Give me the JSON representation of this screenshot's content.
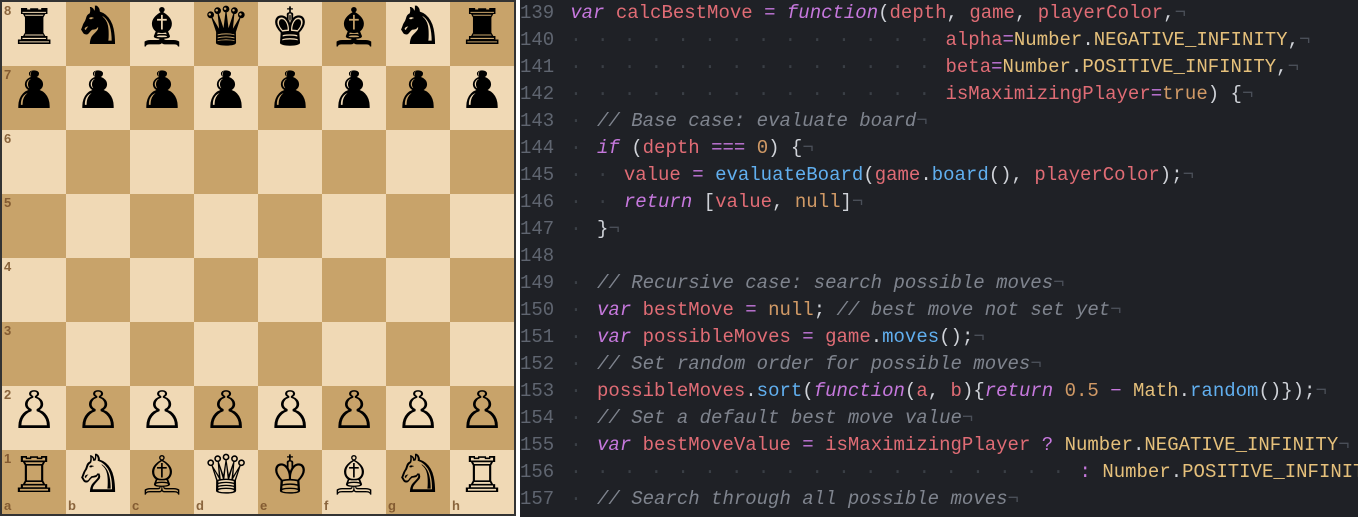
{
  "chess": {
    "ranks": [
      "8",
      "7",
      "6",
      "5",
      "4",
      "3",
      "2",
      "1"
    ],
    "files": [
      "a",
      "b",
      "c",
      "d",
      "e",
      "f",
      "g",
      "h"
    ],
    "position": [
      [
        "♜",
        "♞",
        "♝",
        "♛",
        "♚",
        "♝",
        "♞",
        "♜"
      ],
      [
        "♟",
        "♟",
        "♟",
        "♟",
        "♟",
        "♟",
        "♟",
        "♟"
      ],
      [
        "",
        "",
        "",
        "",
        "",
        "",
        "",
        ""
      ],
      [
        "",
        "",
        "",
        "",
        "",
        "",
        "",
        ""
      ],
      [
        "",
        "",
        "",
        "",
        "",
        "",
        "",
        ""
      ],
      [
        "",
        "",
        "",
        "",
        "",
        "",
        "",
        ""
      ],
      [
        "♙",
        "♙",
        "♙",
        "♙",
        "♙",
        "♙",
        "♙",
        "♙"
      ],
      [
        "♖",
        "♘",
        "♗",
        "♕",
        "♔",
        "♗",
        "♘",
        "♖"
      ]
    ],
    "colors": {
      "light": "#f0d9b5",
      "dark": "#c8a36a"
    }
  },
  "editor": {
    "first_line": 139,
    "lines": [
      {
        "n": 139,
        "tokens": [
          {
            "t": "kw",
            "s": "var"
          },
          {
            "t": "",
            "s": " "
          },
          {
            "t": "var",
            "s": "calcBestMove"
          },
          {
            "t": "",
            "s": " "
          },
          {
            "t": "op",
            "s": "="
          },
          {
            "t": "",
            "s": " "
          },
          {
            "t": "kw",
            "s": "function"
          },
          {
            "t": "paren",
            "s": "("
          },
          {
            "t": "var",
            "s": "depth"
          },
          {
            "t": "",
            "s": ", "
          },
          {
            "t": "var",
            "s": "game"
          },
          {
            "t": "",
            "s": ", "
          },
          {
            "t": "var",
            "s": "playerColor"
          },
          {
            "t": "",
            "s": ","
          },
          {
            "t": "eol",
            "s": "¬"
          }
        ]
      },
      {
        "n": 140,
        "indent": 28,
        "tokens": [
          {
            "t": "var",
            "s": "alpha"
          },
          {
            "t": "op",
            "s": "="
          },
          {
            "t": "const",
            "s": "Number"
          },
          {
            "t": "",
            "s": "."
          },
          {
            "t": "const",
            "s": "NEGATIVE_INFINITY"
          },
          {
            "t": "",
            "s": ","
          },
          {
            "t": "eol",
            "s": "¬"
          }
        ]
      },
      {
        "n": 141,
        "indent": 28,
        "tokens": [
          {
            "t": "var",
            "s": "beta"
          },
          {
            "t": "op",
            "s": "="
          },
          {
            "t": "const",
            "s": "Number"
          },
          {
            "t": "",
            "s": "."
          },
          {
            "t": "const",
            "s": "POSITIVE_INFINITY"
          },
          {
            "t": "",
            "s": ","
          },
          {
            "t": "eol",
            "s": "¬"
          }
        ]
      },
      {
        "n": 142,
        "indent": 28,
        "tokens": [
          {
            "t": "var",
            "s": "isMaximizingPlayer"
          },
          {
            "t": "op",
            "s": "="
          },
          {
            "t": "bool",
            "s": "true"
          },
          {
            "t": "paren",
            "s": ")"
          },
          {
            "t": "",
            "s": " "
          },
          {
            "t": "paren",
            "s": "{"
          },
          {
            "t": "eol",
            "s": "¬"
          }
        ]
      },
      {
        "n": 143,
        "indent": 2,
        "tokens": [
          {
            "t": "cmt",
            "s": "// Base case: evaluate board"
          },
          {
            "t": "eol",
            "s": "¬"
          }
        ]
      },
      {
        "n": 144,
        "indent": 2,
        "tokens": [
          {
            "t": "kw",
            "s": "if"
          },
          {
            "t": "",
            "s": " "
          },
          {
            "t": "paren",
            "s": "("
          },
          {
            "t": "var",
            "s": "depth"
          },
          {
            "t": "",
            "s": " "
          },
          {
            "t": "op",
            "s": "==="
          },
          {
            "t": "",
            "s": " "
          },
          {
            "t": "num",
            "s": "0"
          },
          {
            "t": "paren",
            "s": ")"
          },
          {
            "t": "",
            "s": " "
          },
          {
            "t": "paren",
            "s": "{"
          },
          {
            "t": "eol",
            "s": "¬"
          }
        ]
      },
      {
        "n": 145,
        "indent": 4,
        "tokens": [
          {
            "t": "var",
            "s": "value"
          },
          {
            "t": "",
            "s": " "
          },
          {
            "t": "op",
            "s": "="
          },
          {
            "t": "",
            "s": " "
          },
          {
            "t": "call",
            "s": "evaluateBoard"
          },
          {
            "t": "paren",
            "s": "("
          },
          {
            "t": "var",
            "s": "game"
          },
          {
            "t": "",
            "s": "."
          },
          {
            "t": "call",
            "s": "board"
          },
          {
            "t": "paren",
            "s": "()"
          },
          {
            "t": "",
            "s": ", "
          },
          {
            "t": "var",
            "s": "playerColor"
          },
          {
            "t": "paren",
            "s": ")"
          },
          {
            "t": "",
            "s": ";"
          },
          {
            "t": "eol",
            "s": "¬"
          }
        ]
      },
      {
        "n": 146,
        "indent": 4,
        "tokens": [
          {
            "t": "kw",
            "s": "return"
          },
          {
            "t": "",
            "s": " "
          },
          {
            "t": "paren",
            "s": "["
          },
          {
            "t": "var",
            "s": "value"
          },
          {
            "t": "",
            "s": ", "
          },
          {
            "t": "bool",
            "s": "null"
          },
          {
            "t": "paren",
            "s": "]"
          },
          {
            "t": "eol",
            "s": "¬"
          }
        ]
      },
      {
        "n": 147,
        "indent": 2,
        "tokens": [
          {
            "t": "paren",
            "s": "}"
          },
          {
            "t": "eol",
            "s": "¬"
          }
        ]
      },
      {
        "n": 148,
        "indent": 0,
        "tokens": [
          {
            "t": "eol",
            "s": ""
          }
        ]
      },
      {
        "n": 149,
        "indent": 2,
        "tokens": [
          {
            "t": "cmt",
            "s": "// Recursive case: search possible moves"
          },
          {
            "t": "eol",
            "s": "¬"
          }
        ]
      },
      {
        "n": 150,
        "indent": 2,
        "tokens": [
          {
            "t": "kw",
            "s": "var"
          },
          {
            "t": "",
            "s": " "
          },
          {
            "t": "var",
            "s": "bestMove"
          },
          {
            "t": "",
            "s": " "
          },
          {
            "t": "op",
            "s": "="
          },
          {
            "t": "",
            "s": " "
          },
          {
            "t": "bool",
            "s": "null"
          },
          {
            "t": "",
            "s": "; "
          },
          {
            "t": "cmt",
            "s": "// best move not set yet"
          },
          {
            "t": "eol",
            "s": "¬"
          }
        ]
      },
      {
        "n": 151,
        "indent": 2,
        "tokens": [
          {
            "t": "kw",
            "s": "var"
          },
          {
            "t": "",
            "s": " "
          },
          {
            "t": "var",
            "s": "possibleMoves"
          },
          {
            "t": "",
            "s": " "
          },
          {
            "t": "op",
            "s": "="
          },
          {
            "t": "",
            "s": " "
          },
          {
            "t": "var",
            "s": "game"
          },
          {
            "t": "",
            "s": "."
          },
          {
            "t": "call",
            "s": "moves"
          },
          {
            "t": "paren",
            "s": "()"
          },
          {
            "t": "",
            "s": ";"
          },
          {
            "t": "eol",
            "s": "¬"
          }
        ]
      },
      {
        "n": 152,
        "indent": 2,
        "tokens": [
          {
            "t": "cmt",
            "s": "// Set random order for possible moves"
          },
          {
            "t": "eol",
            "s": "¬"
          }
        ]
      },
      {
        "n": 153,
        "indent": 2,
        "tokens": [
          {
            "t": "var",
            "s": "possibleMoves"
          },
          {
            "t": "",
            "s": "."
          },
          {
            "t": "call",
            "s": "sort"
          },
          {
            "t": "paren",
            "s": "("
          },
          {
            "t": "kw",
            "s": "function"
          },
          {
            "t": "paren",
            "s": "("
          },
          {
            "t": "var",
            "s": "a"
          },
          {
            "t": "",
            "s": ", "
          },
          {
            "t": "var",
            "s": "b"
          },
          {
            "t": "paren",
            "s": "){"
          },
          {
            "t": "kw",
            "s": "return"
          },
          {
            "t": "",
            "s": " "
          },
          {
            "t": "num",
            "s": "0.5"
          },
          {
            "t": "",
            "s": " "
          },
          {
            "t": "op",
            "s": "−"
          },
          {
            "t": "",
            "s": " "
          },
          {
            "t": "const",
            "s": "Math"
          },
          {
            "t": "",
            "s": "."
          },
          {
            "t": "call",
            "s": "random"
          },
          {
            "t": "paren",
            "s": "()});"
          },
          {
            "t": "eol",
            "s": "¬"
          }
        ]
      },
      {
        "n": 154,
        "indent": 2,
        "tokens": [
          {
            "t": "cmt",
            "s": "// Set a default best move value"
          },
          {
            "t": "eol",
            "s": "¬"
          }
        ]
      },
      {
        "n": 155,
        "indent": 2,
        "tokens": [
          {
            "t": "kw",
            "s": "var"
          },
          {
            "t": "",
            "s": " "
          },
          {
            "t": "var",
            "s": "bestMoveValue"
          },
          {
            "t": "",
            "s": " "
          },
          {
            "t": "op",
            "s": "="
          },
          {
            "t": "",
            "s": " "
          },
          {
            "t": "var",
            "s": "isMaximizingPlayer"
          },
          {
            "t": "",
            "s": " "
          },
          {
            "t": "op",
            "s": "?"
          },
          {
            "t": "",
            "s": " "
          },
          {
            "t": "const",
            "s": "Number"
          },
          {
            "t": "",
            "s": "."
          },
          {
            "t": "const",
            "s": "NEGATIVE_INFINITY"
          },
          {
            "t": "eol",
            "s": "¬"
          }
        ]
      },
      {
        "n": 156,
        "indent": 38,
        "tokens": [
          {
            "t": "op",
            "s": ":"
          },
          {
            "t": "",
            "s": " "
          },
          {
            "t": "const",
            "s": "Number"
          },
          {
            "t": "",
            "s": "."
          },
          {
            "t": "const",
            "s": "POSITIVE_INFINITY"
          },
          {
            "t": "",
            "s": ";"
          },
          {
            "t": "eol",
            "s": ""
          }
        ]
      },
      {
        "n": 157,
        "indent": 2,
        "tokens": [
          {
            "t": "cmt",
            "s": "// Search through all possible moves"
          },
          {
            "t": "eol",
            "s": "¬"
          }
        ]
      }
    ]
  }
}
